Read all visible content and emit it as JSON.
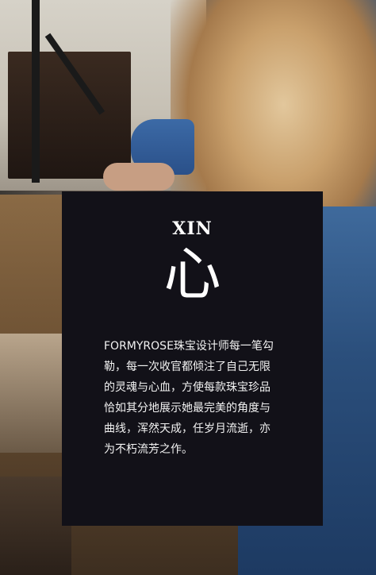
{
  "card": {
    "title": "XIN",
    "character": "心",
    "lines": [
      "FORMYROSE珠宝设计师每一笔勾",
      "勒，每一次收官都倾注了自己无限",
      "的灵魂与心血，方使每款珠宝珍品",
      "恰如其分地展示她最完美的角度与",
      "曲线，浑然天成，任岁月流逝，亦",
      "为不朽流芳之作。"
    ]
  }
}
